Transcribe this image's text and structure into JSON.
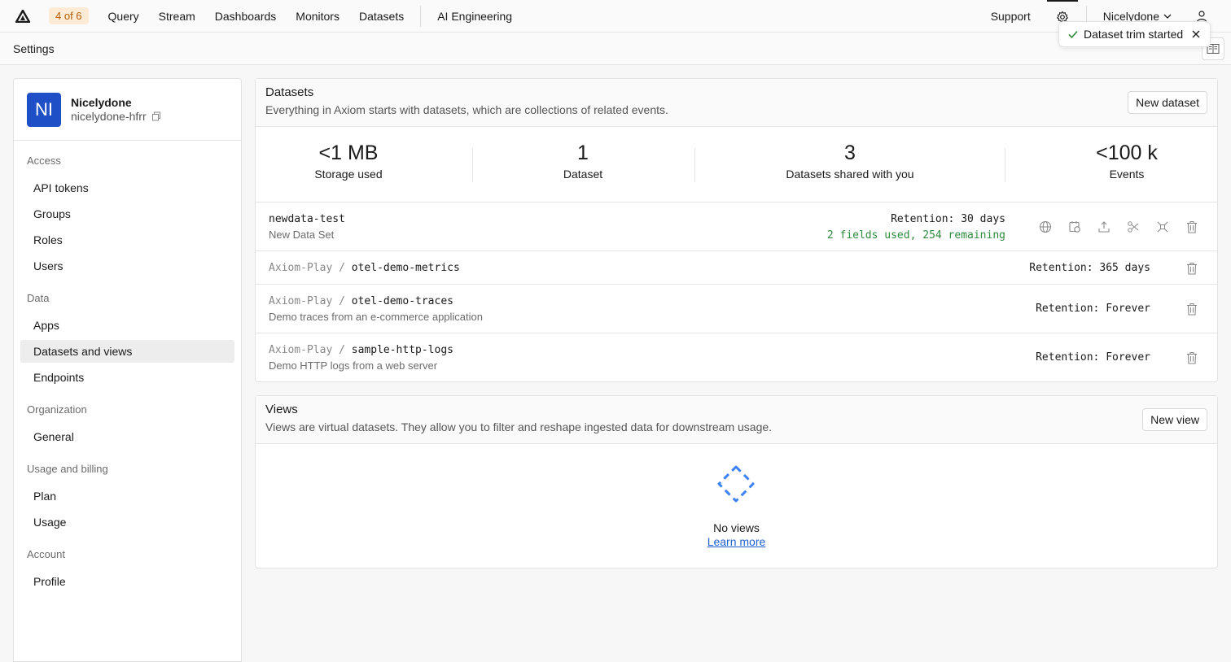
{
  "topnav": {
    "logo_icon": "axiom-logo-icon",
    "badge": "4 of 6",
    "items": [
      "Query",
      "Stream",
      "Dashboards",
      "Monitors",
      "Datasets"
    ],
    "ai": "AI Engineering",
    "support": "Support",
    "user": "Nicelydone"
  },
  "toast": {
    "text": "Dataset trim started"
  },
  "page": {
    "title": "Settings"
  },
  "sidebar": {
    "avatar": "NI",
    "org_name": "Nicelydone",
    "org_slug": "nicelydone-hfrr",
    "sections": {
      "access": "Access",
      "data": "Data",
      "organization": "Organization",
      "billing": "Usage and billing",
      "account": "Account"
    },
    "items": {
      "api_tokens": "API tokens",
      "groups": "Groups",
      "roles": "Roles",
      "users": "Users",
      "apps": "Apps",
      "datasets_views": "Datasets and views",
      "endpoints": "Endpoints",
      "general": "General",
      "plan": "Plan",
      "usage": "Usage",
      "profile": "Profile"
    }
  },
  "datasets": {
    "title": "Datasets",
    "subtitle": "Everything in Axiom starts with datasets, which are collections of related events.",
    "new_button": "New dataset",
    "stats": [
      {
        "value": "<1 MB",
        "label": "Storage used"
      },
      {
        "value": "1",
        "label": "Dataset"
      },
      {
        "value": "3",
        "label": "Datasets shared with you"
      },
      {
        "value": "<100 k",
        "label": "Events"
      }
    ],
    "rows": [
      {
        "owner": "",
        "name": "newdata-test",
        "description": "New Data Set",
        "retention": "Retention: 30 days",
        "fields": "2 fields used, 254 remaining"
      },
      {
        "owner": "Axiom-Play",
        "name": "otel-demo-metrics",
        "description": "",
        "retention": "Retention: 365 days"
      },
      {
        "owner": "Axiom-Play",
        "name": "otel-demo-traces",
        "description": "Demo traces from an e-commerce application",
        "retention": "Retention: Forever"
      },
      {
        "owner": "Axiom-Play",
        "name": "sample-http-logs",
        "description": "Demo HTTP logs from a web server",
        "retention": "Retention: Forever"
      }
    ],
    "separator": "/"
  },
  "views": {
    "title": "Views",
    "subtitle": "Views are virtual datasets. They allow you to filter and reshape ingested data for downstream usage.",
    "new_button": "New view",
    "empty_title": "No views",
    "learn_more": "Learn more"
  },
  "colors": {
    "accent": "#1f4fc6",
    "badge_bg": "#fdebd6",
    "badge_fg": "#b35b00",
    "green": "#2f8a3d",
    "link": "#1f5fd0",
    "empty_icon": "#3b82f6"
  }
}
